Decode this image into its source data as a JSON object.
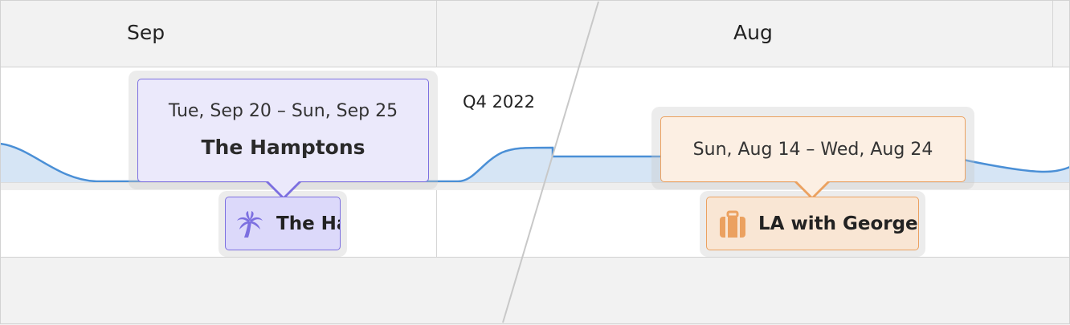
{
  "header": {
    "months": [
      "Sep",
      "Aug"
    ]
  },
  "timeline": {
    "quarter_label": "Q4 2022"
  },
  "events": [
    {
      "dates": "Tue, Sep 20 – Sun, Sep 25",
      "title": "The Hamptons",
      "chip_label": "The Ha",
      "icon": "palm-tree-icon",
      "color": "#7c6fe0"
    },
    {
      "dates": "Sun, Aug 14 – Wed, Aug 24",
      "title": "",
      "chip_label": "LA with George",
      "icon": "suitcase-icon",
      "color": "#eba160"
    }
  ],
  "colors": {
    "curve": "#4a8fd6",
    "curve_fill": "#d6e5f5",
    "header_bg": "#f2f2f2"
  }
}
